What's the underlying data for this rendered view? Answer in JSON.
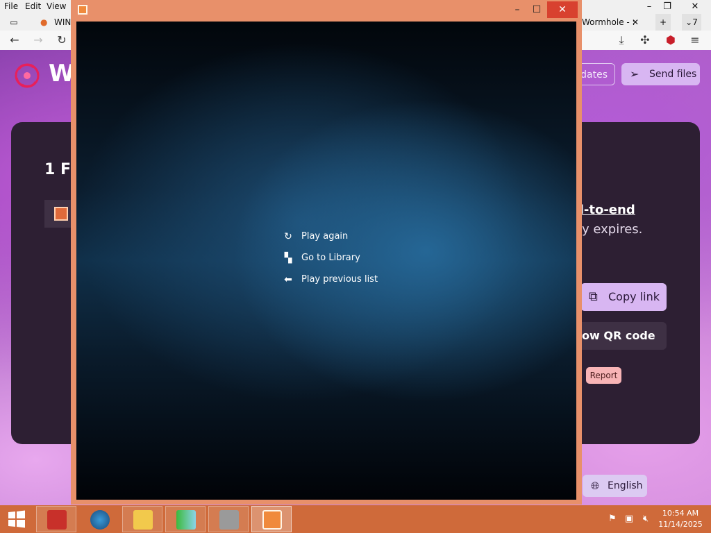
{
  "browser": {
    "menu": [
      "File",
      "Edit",
      "View"
    ],
    "tabs": {
      "tab1_label": "WIN",
      "tab2_label": "Wormhole - :",
      "tab_count": "7"
    },
    "page": {
      "logo_text": "W",
      "updates_label": "dates",
      "send_label": "Send files",
      "file_count_title": "1 Fi",
      "e2e_text": "d-to-end",
      "expires_text": "lly expires.",
      "copy_label": "Copy link",
      "qr_label": "ow QR code",
      "report_label": "Report",
      "language_label": "English"
    }
  },
  "player": {
    "menu": [
      {
        "icon": "refresh-icon",
        "label": "Play again"
      },
      {
        "icon": "library-icon",
        "label": "Go to Library"
      },
      {
        "icon": "back-arrow-icon",
        "label": "Play previous list"
      }
    ]
  },
  "taskbar": {
    "time": "10:54 AM",
    "date": "11/14/2025"
  },
  "colors": {
    "player_frame": "#e8906a",
    "taskbar": "#cf6a3a",
    "accent_purple": "#d8b6f2",
    "close_red": "#d8412f"
  }
}
